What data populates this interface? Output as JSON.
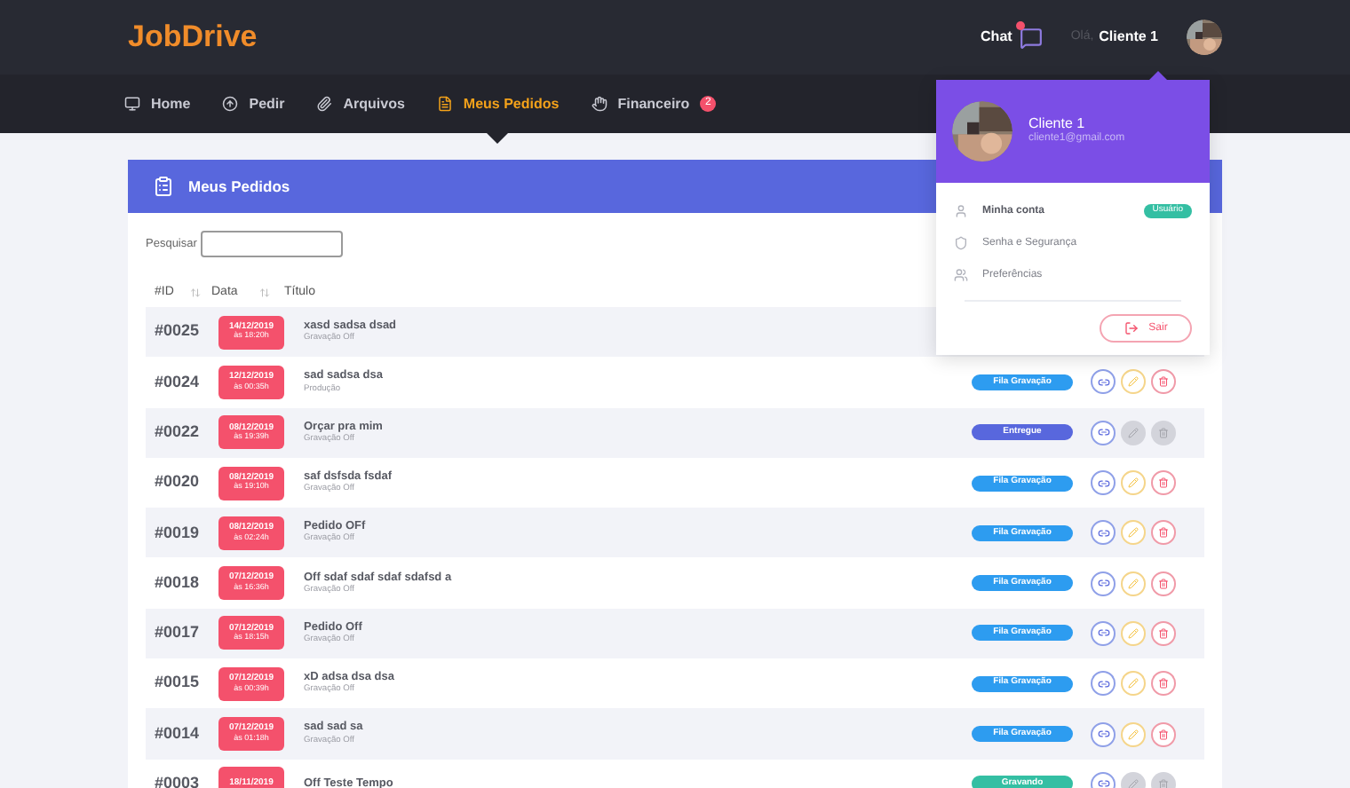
{
  "logo": "JobDrive",
  "top_bar": {
    "chat": "Chat",
    "chat_unread": true,
    "greeting": "Olá,",
    "user": "Cliente 1"
  },
  "nav": [
    {
      "label": "Home",
      "selected": false
    },
    {
      "label": "Pedir",
      "selected": false
    },
    {
      "label": "Arquivos",
      "selected": false
    },
    {
      "label": "Meus Pedidos",
      "selected": true
    },
    {
      "label": "Financeiro",
      "selected": false,
      "badge": "2"
    }
  ],
  "card": {
    "title": "Meus Pedidos",
    "search_label": "Pesquisar",
    "columns": [
      "#ID",
      "Data",
      "Título"
    ],
    "rows": [
      {
        "id": "#0025",
        "date": "14/12/2019",
        "time": "às 18:20h",
        "title": "xasd sadsa dsad",
        "subtitle": "Gravação Off"
      },
      {
        "id": "#0024",
        "date": "12/12/2019",
        "time": "às 00:35h",
        "title": "sad sadsa dsa",
        "subtitle": "Produção",
        "status": "Fila Gravação",
        "color": "#2d9cf0",
        "actions_disabled": false
      },
      {
        "id": "#0022",
        "date": "08/12/2019",
        "time": "às 19:39h",
        "title": "Orçar pra mim",
        "subtitle": "Gravação Off",
        "status": "Entregue",
        "color": "#5867dd",
        "actions_disabled": true
      },
      {
        "id": "#0020",
        "date": "08/12/2019",
        "time": "às 19:10h",
        "title": "saf dsfsda fsdaf",
        "subtitle": "Gravação Off",
        "status": "Fila Gravação",
        "color": "#2d9cf0",
        "actions_disabled": false
      },
      {
        "id": "#0019",
        "date": "08/12/2019",
        "time": "às 02:24h",
        "title": "Pedido OFf",
        "subtitle": "Gravação Off",
        "status": "Fila Gravação",
        "color": "#2d9cf0",
        "actions_disabled": false
      },
      {
        "id": "#0018",
        "date": "07/12/2019",
        "time": "às 16:36h",
        "title": "Off sdaf sdaf sdaf sdafsd a",
        "subtitle": "Gravação Off",
        "status": "Fila Gravação",
        "color": "#2d9cf0",
        "actions_disabled": false
      },
      {
        "id": "#0017",
        "date": "07/12/2019",
        "time": "às 18:15h",
        "title": "Pedido Off",
        "subtitle": "Gravação Off",
        "status": "Fila Gravação",
        "color": "#2d9cf0",
        "actions_disabled": false
      },
      {
        "id": "#0015",
        "date": "07/12/2019",
        "time": "às 00:39h",
        "title": "xD adsa dsa dsa",
        "subtitle": "Gravação Off",
        "status": "Fila Gravação",
        "color": "#2d9cf0",
        "actions_disabled": false
      },
      {
        "id": "#0014",
        "date": "07/12/2019",
        "time": "às 01:18h",
        "title": "sad sad sa",
        "subtitle": "Gravação Off",
        "status": "Fila Gravação",
        "color": "#2d9cf0",
        "actions_disabled": false
      },
      {
        "id": "#0003",
        "date": "18/11/2019",
        "title": "Off Teste Tempo",
        "status": "Gravando",
        "color": "#34bfa3",
        "actions_disabled": true
      }
    ]
  },
  "user_menu": {
    "name": "Cliente 1",
    "email": "cliente1@gmail.com",
    "items": [
      {
        "label": "Minha conta",
        "badge": "Usuário",
        "bold": true
      },
      {
        "label": "Senha e Segurança",
        "bold": false
      },
      {
        "label": "Preferências",
        "bold": false
      }
    ],
    "logout": "Sair"
  }
}
